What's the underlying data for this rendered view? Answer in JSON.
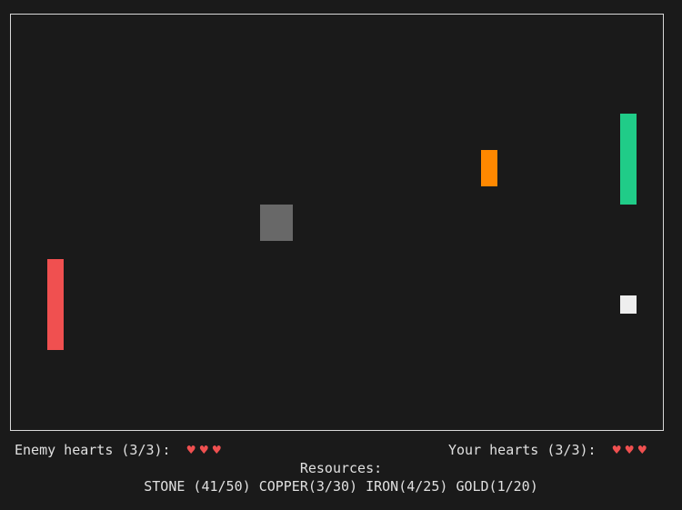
{
  "colors": {
    "background": "#1a1a1a",
    "border": "#d8d8d8",
    "text": "#e0e0e0",
    "heart": "#f05050",
    "enemy_paddle": "#f05050",
    "player_paddle": "#20cc88",
    "resource_pickup": "#ff8800",
    "obstacle": "#686868",
    "ball": "#eeeeee"
  },
  "hud": {
    "enemy_hearts_label": "Enemy hearts (3/3):",
    "enemy_hearts": [
      "♥",
      "♥",
      "♥"
    ],
    "player_hearts_label": "Your hearts (3/3):",
    "player_hearts": [
      "♥",
      "♥",
      "♥"
    ],
    "resources_title": "Resources:",
    "resources": {
      "stone": "STONE (41/50)",
      "copper": "COPPER(3/30)",
      "iron": "IRON(4/25)",
      "gold": "GOLD(1/20)"
    }
  }
}
